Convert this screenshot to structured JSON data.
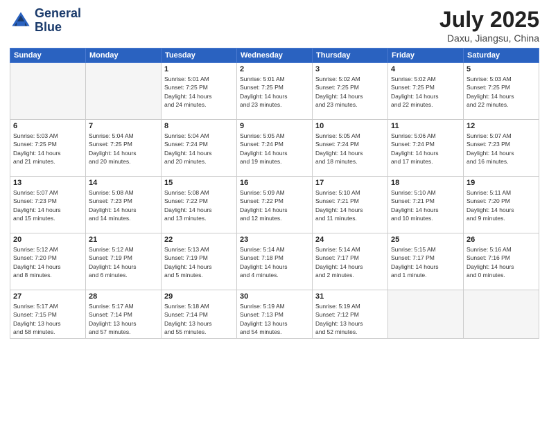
{
  "header": {
    "logo_line1": "General",
    "logo_line2": "Blue",
    "month": "July 2025",
    "location": "Daxu, Jiangsu, China"
  },
  "weekdays": [
    "Sunday",
    "Monday",
    "Tuesday",
    "Wednesday",
    "Thursday",
    "Friday",
    "Saturday"
  ],
  "weeks": [
    [
      {
        "day": "",
        "info": ""
      },
      {
        "day": "",
        "info": ""
      },
      {
        "day": "1",
        "info": "Sunrise: 5:01 AM\nSunset: 7:25 PM\nDaylight: 14 hours\nand 24 minutes."
      },
      {
        "day": "2",
        "info": "Sunrise: 5:01 AM\nSunset: 7:25 PM\nDaylight: 14 hours\nand 23 minutes."
      },
      {
        "day": "3",
        "info": "Sunrise: 5:02 AM\nSunset: 7:25 PM\nDaylight: 14 hours\nand 23 minutes."
      },
      {
        "day": "4",
        "info": "Sunrise: 5:02 AM\nSunset: 7:25 PM\nDaylight: 14 hours\nand 22 minutes."
      },
      {
        "day": "5",
        "info": "Sunrise: 5:03 AM\nSunset: 7:25 PM\nDaylight: 14 hours\nand 22 minutes."
      }
    ],
    [
      {
        "day": "6",
        "info": "Sunrise: 5:03 AM\nSunset: 7:25 PM\nDaylight: 14 hours\nand 21 minutes."
      },
      {
        "day": "7",
        "info": "Sunrise: 5:04 AM\nSunset: 7:25 PM\nDaylight: 14 hours\nand 20 minutes."
      },
      {
        "day": "8",
        "info": "Sunrise: 5:04 AM\nSunset: 7:24 PM\nDaylight: 14 hours\nand 20 minutes."
      },
      {
        "day": "9",
        "info": "Sunrise: 5:05 AM\nSunset: 7:24 PM\nDaylight: 14 hours\nand 19 minutes."
      },
      {
        "day": "10",
        "info": "Sunrise: 5:05 AM\nSunset: 7:24 PM\nDaylight: 14 hours\nand 18 minutes."
      },
      {
        "day": "11",
        "info": "Sunrise: 5:06 AM\nSunset: 7:24 PM\nDaylight: 14 hours\nand 17 minutes."
      },
      {
        "day": "12",
        "info": "Sunrise: 5:07 AM\nSunset: 7:23 PM\nDaylight: 14 hours\nand 16 minutes."
      }
    ],
    [
      {
        "day": "13",
        "info": "Sunrise: 5:07 AM\nSunset: 7:23 PM\nDaylight: 14 hours\nand 15 minutes."
      },
      {
        "day": "14",
        "info": "Sunrise: 5:08 AM\nSunset: 7:23 PM\nDaylight: 14 hours\nand 14 minutes."
      },
      {
        "day": "15",
        "info": "Sunrise: 5:08 AM\nSunset: 7:22 PM\nDaylight: 14 hours\nand 13 minutes."
      },
      {
        "day": "16",
        "info": "Sunrise: 5:09 AM\nSunset: 7:22 PM\nDaylight: 14 hours\nand 12 minutes."
      },
      {
        "day": "17",
        "info": "Sunrise: 5:10 AM\nSunset: 7:21 PM\nDaylight: 14 hours\nand 11 minutes."
      },
      {
        "day": "18",
        "info": "Sunrise: 5:10 AM\nSunset: 7:21 PM\nDaylight: 14 hours\nand 10 minutes."
      },
      {
        "day": "19",
        "info": "Sunrise: 5:11 AM\nSunset: 7:20 PM\nDaylight: 14 hours\nand 9 minutes."
      }
    ],
    [
      {
        "day": "20",
        "info": "Sunrise: 5:12 AM\nSunset: 7:20 PM\nDaylight: 14 hours\nand 8 minutes."
      },
      {
        "day": "21",
        "info": "Sunrise: 5:12 AM\nSunset: 7:19 PM\nDaylight: 14 hours\nand 6 minutes."
      },
      {
        "day": "22",
        "info": "Sunrise: 5:13 AM\nSunset: 7:19 PM\nDaylight: 14 hours\nand 5 minutes."
      },
      {
        "day": "23",
        "info": "Sunrise: 5:14 AM\nSunset: 7:18 PM\nDaylight: 14 hours\nand 4 minutes."
      },
      {
        "day": "24",
        "info": "Sunrise: 5:14 AM\nSunset: 7:17 PM\nDaylight: 14 hours\nand 2 minutes."
      },
      {
        "day": "25",
        "info": "Sunrise: 5:15 AM\nSunset: 7:17 PM\nDaylight: 14 hours\nand 1 minute."
      },
      {
        "day": "26",
        "info": "Sunrise: 5:16 AM\nSunset: 7:16 PM\nDaylight: 14 hours\nand 0 minutes."
      }
    ],
    [
      {
        "day": "27",
        "info": "Sunrise: 5:17 AM\nSunset: 7:15 PM\nDaylight: 13 hours\nand 58 minutes."
      },
      {
        "day": "28",
        "info": "Sunrise: 5:17 AM\nSunset: 7:14 PM\nDaylight: 13 hours\nand 57 minutes."
      },
      {
        "day": "29",
        "info": "Sunrise: 5:18 AM\nSunset: 7:14 PM\nDaylight: 13 hours\nand 55 minutes."
      },
      {
        "day": "30",
        "info": "Sunrise: 5:19 AM\nSunset: 7:13 PM\nDaylight: 13 hours\nand 54 minutes."
      },
      {
        "day": "31",
        "info": "Sunrise: 5:19 AM\nSunset: 7:12 PM\nDaylight: 13 hours\nand 52 minutes."
      },
      {
        "day": "",
        "info": ""
      },
      {
        "day": "",
        "info": ""
      }
    ]
  ]
}
